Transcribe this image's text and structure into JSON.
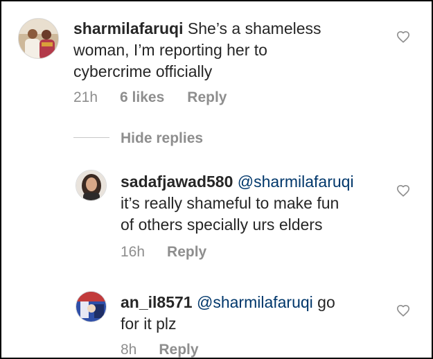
{
  "comments": [
    {
      "username": "sharmilafaruqi",
      "mention": "",
      "text_line1": "She’s a shameless",
      "text_line2": "woman, I’m reporting her to",
      "text_line3": "cybercrime officially",
      "time": "21h",
      "likes": "6 likes",
      "reply": "Reply"
    }
  ],
  "hide_replies_label": "Hide replies",
  "replies": [
    {
      "username": "sadafjawad580",
      "mention": "@sharmilafaruqi",
      "text_line1": "it’s really shameful to make fun",
      "text_line2": "of others specially urs elders",
      "time": "16h",
      "reply": "Reply"
    },
    {
      "username": "an_il8571",
      "mention": "@sharmilafaruqi",
      "text_tail": "go",
      "text_line2": "for it plz",
      "time": "8h",
      "reply": "Reply"
    }
  ],
  "colors": {
    "text": "#262626",
    "mention": "#00376b",
    "secondary": "#8e8e8e",
    "border": "#000000"
  },
  "icons": {
    "like": "heart-outline-icon"
  }
}
